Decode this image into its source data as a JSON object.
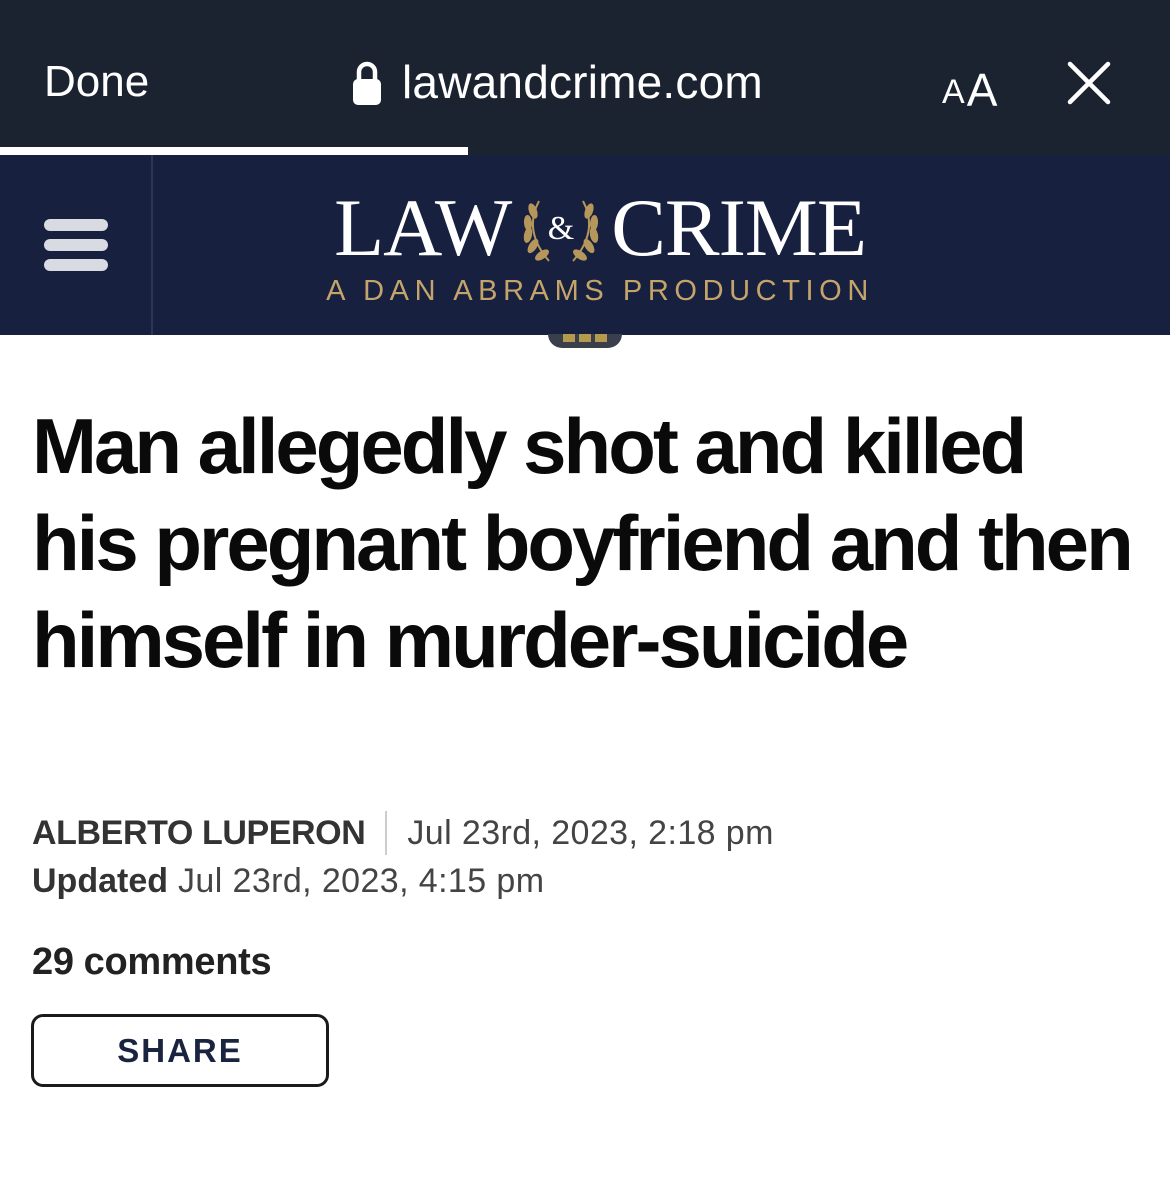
{
  "browser": {
    "done_label": "Done",
    "url": "lawandcrime.com",
    "text_size_small": "A",
    "text_size_large": "A",
    "load_progress_fraction": 0.4,
    "bar_color": "#1b2230"
  },
  "site": {
    "logo_left": "LAW",
    "logo_ampersand": "&",
    "logo_right": "CRIME",
    "tagline": "A DAN ABRAMS PRODUCTION",
    "header_color": "#17203f",
    "accent_gold": "#c4a46a"
  },
  "icons": {
    "lock": "lock-icon",
    "close": "close-icon",
    "menu": "hamburger-menu-icon",
    "laurel": "laurel-wreath-icon"
  },
  "article": {
    "headline": "Man allegedly shot and killed his pregnant boyfriend and then himself in murder-suicide",
    "author": "ALBERTO LUPERON",
    "published": "Jul 23rd, 2023, 2:18 pm",
    "updated_label": "Updated",
    "updated": "Jul 23rd, 2023, 4:15 pm",
    "comments_count": "29",
    "comments_label": "comments",
    "share_label": "SHARE"
  }
}
